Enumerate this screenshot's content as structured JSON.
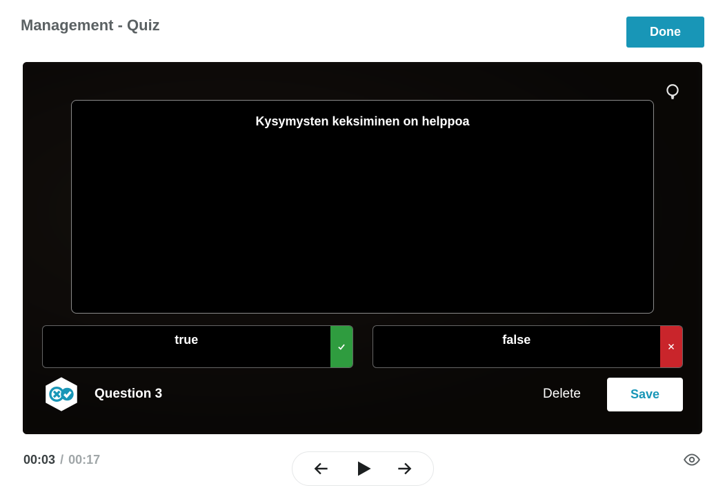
{
  "header": {
    "title": "Management - Quiz",
    "done_label": "Done"
  },
  "question": {
    "prompt": "Kysymysten keksiminen on helppoa",
    "answers": [
      {
        "label": "true",
        "is_correct": true
      },
      {
        "label": "false",
        "is_correct": false
      }
    ],
    "badge_label": "Question 3",
    "delete_label": "Delete",
    "save_label": "Save"
  },
  "timeline": {
    "current": "00:03",
    "total": "00:17"
  },
  "colors": {
    "accent": "#1896b7",
    "correct": "#2f9c3f",
    "wrong": "#c9252b"
  }
}
